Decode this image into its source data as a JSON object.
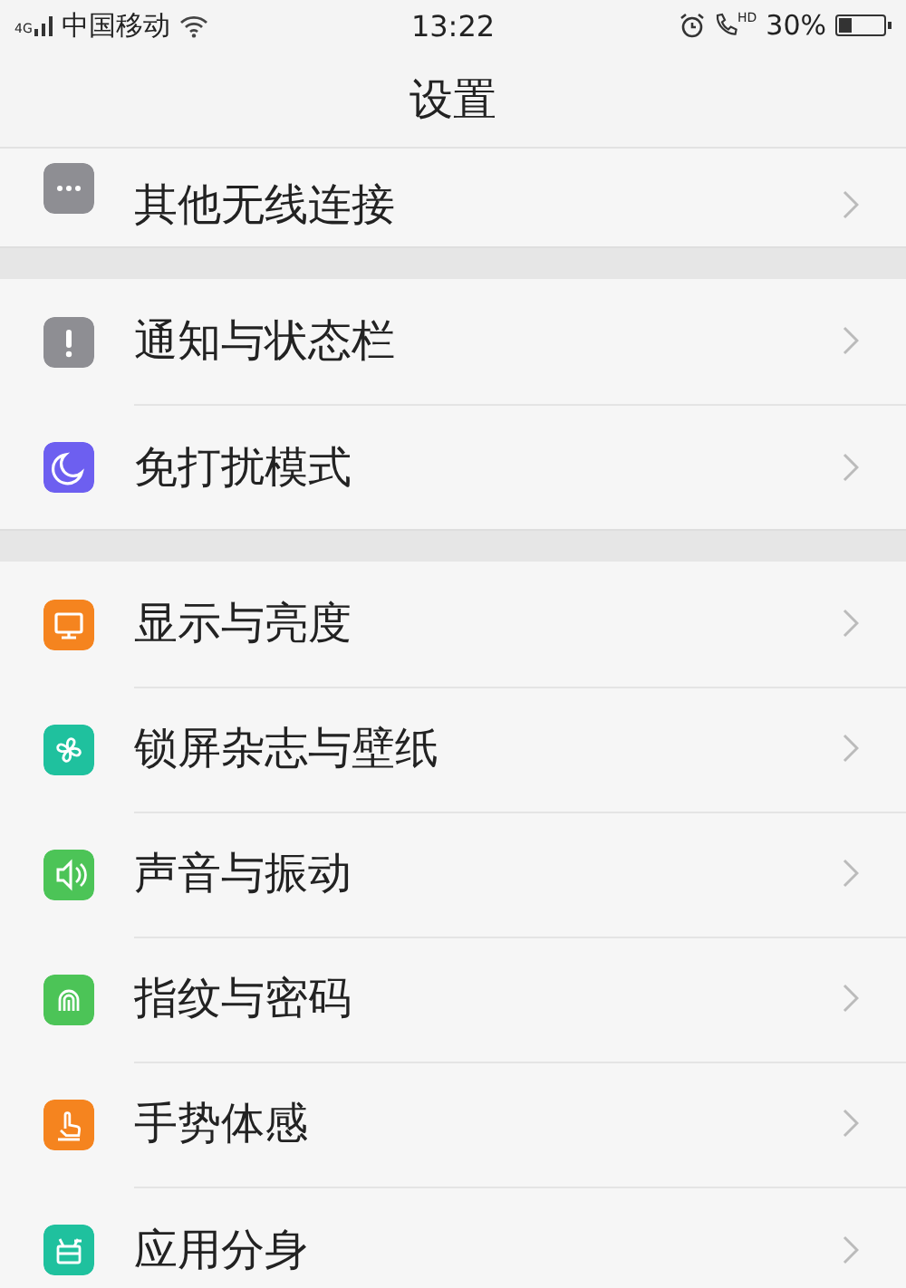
{
  "status_bar": {
    "network": "4G",
    "carrier": "中国移动",
    "time": "13:22",
    "call_badge": "HD",
    "battery": "30%"
  },
  "title": "设置",
  "groups": [
    {
      "items": [
        {
          "label": "其他无线连接",
          "color": "#8e8e93"
        }
      ]
    },
    {
      "items": [
        {
          "label": "通知与状态栏",
          "color": "#8e8e93"
        },
        {
          "label": "免打扰模式",
          "color": "#6d5ff0"
        }
      ]
    },
    {
      "items": [
        {
          "label": "显示与亮度",
          "color": "#f5841f"
        },
        {
          "label": "锁屏杂志与壁纸",
          "color": "#1fc19e"
        },
        {
          "label": "声音与振动",
          "color": "#4cc457"
        },
        {
          "label": "指纹与密码",
          "color": "#4cc457"
        },
        {
          "label": "手势体感",
          "color": "#f5841f"
        },
        {
          "label": "应用分身",
          "color": "#1fc19e"
        }
      ]
    }
  ]
}
